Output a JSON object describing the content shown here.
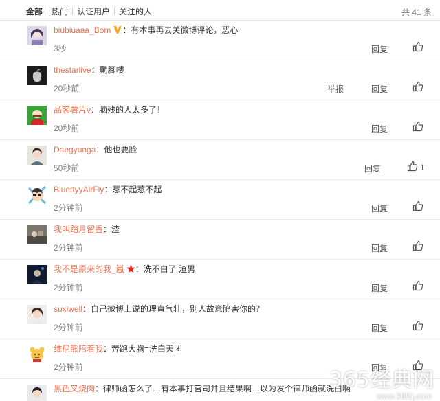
{
  "filters": {
    "tabs": [
      "全部",
      "热门",
      "认证用户",
      "关注的人"
    ],
    "total": "共 41 条"
  },
  "comments": [
    {
      "user": "biubiuaaa_Bom",
      "text": "有本事再去关微博评论，恶心",
      "time": "3秒",
      "reply": "回复",
      "badge": "vip-v-icon"
    },
    {
      "user": "thestarlive",
      "text": "動腳嘍",
      "time": "20秒前",
      "reply": "回复",
      "report": "举报"
    },
    {
      "user": "品客薯片v",
      "text": "脑残的人太多了！",
      "time": "20秒前",
      "reply": "回复"
    },
    {
      "user": "Daegyunga",
      "text": "他也要脸",
      "time": "50秒前",
      "reply": "回复",
      "likes": "1"
    },
    {
      "user": "BluettyyAirFly",
      "text": "惹不起惹不起",
      "time": "2分钟前",
      "reply": "回复"
    },
    {
      "user": "我叫踏月留香",
      "text": "渣",
      "time": "2分钟前",
      "reply": "回复"
    },
    {
      "user": "我不是原来的我_嵐",
      "text": "洗不白了 渣男",
      "time": "2分钟前",
      "reply": "回复",
      "badge": "star-icon"
    },
    {
      "user": "suxiwell",
      "text": "自己微博上说的理直气壮，别人故意陷害你的？",
      "time": "2分钟前",
      "reply": "回复"
    },
    {
      "user": "维尼熊陪着我",
      "text": "奔跑大胸=洗白天团",
      "time": "2分钟前",
      "reply": "回复"
    },
    {
      "user": "黑色叉烧肉",
      "text": "律师函怎么了…有本事打官司并且结果啊…以为发个律师函就洗白啊"
    }
  ],
  "watermark": {
    "main": "365经典网",
    "sub": "www.365jj.com"
  },
  "colors": {
    "username": "#eb7350",
    "text": "#333333",
    "meta": "#808080"
  }
}
